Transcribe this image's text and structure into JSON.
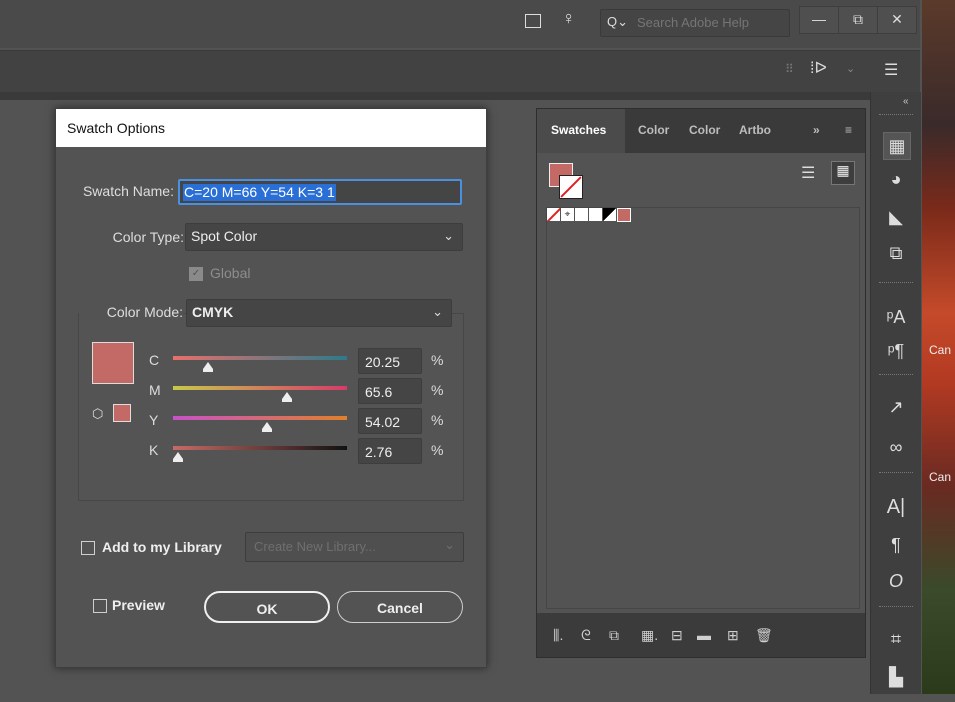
{
  "search": {
    "placeholder": "Search Adobe Help"
  },
  "window": {
    "minimize": "—",
    "restore": "⧉",
    "close": "✕"
  },
  "dialog": {
    "title": "Swatch Options",
    "swatch_name_label": "Swatch Name:",
    "swatch_name_value": "C=20 M=66 Y=54 K=3 1",
    "color_type_label": "Color Type:",
    "color_type_value": "Spot Color",
    "global_label": "Global",
    "color_mode_label": "Color Mode:",
    "color_mode_value": "CMYK",
    "swatch_color": "#c46a66",
    "sliders": [
      {
        "letter": "C",
        "value": "20.25",
        "unit": "%",
        "fraction": 0.2025
      },
      {
        "letter": "M",
        "value": "65.6",
        "unit": "%",
        "fraction": 0.656
      },
      {
        "letter": "Y",
        "value": "54.02",
        "unit": "%",
        "fraction": 0.5402
      },
      {
        "letter": "K",
        "value": "2.76",
        "unit": "%",
        "fraction": 0.0276
      }
    ],
    "add_library_label": "Add to my Library",
    "library_placeholder": "Create New Library...",
    "preview_label": "Preview",
    "ok_label": "OK",
    "cancel_label": "Cancel"
  },
  "panel": {
    "tabs": [
      "Swatches",
      "Color",
      "Color",
      "Artbo"
    ],
    "overflow": "»",
    "menu": "≡"
  },
  "background": {
    "side_text_1": "Can",
    "side_text_2": "Can"
  }
}
